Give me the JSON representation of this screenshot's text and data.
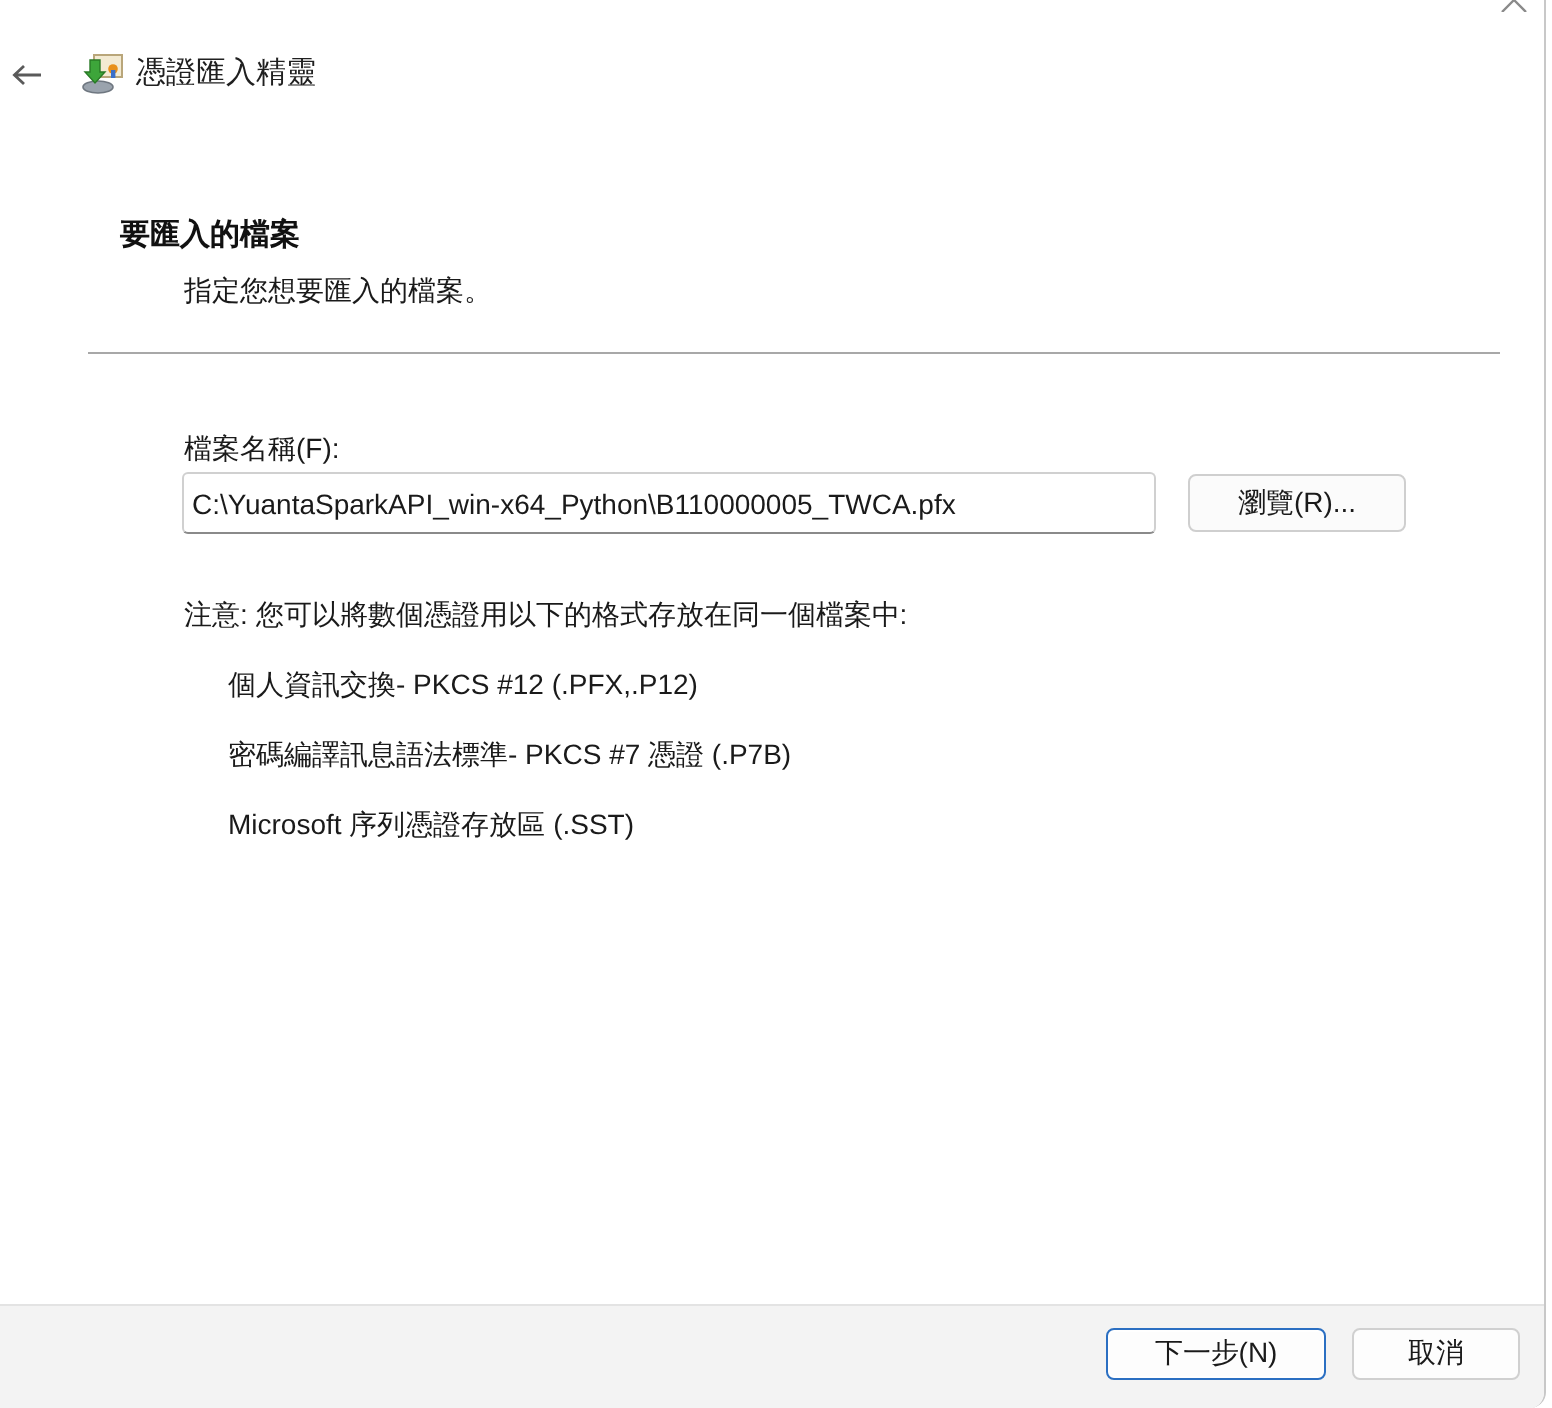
{
  "window": {
    "title": "憑證匯入精靈"
  },
  "page": {
    "heading": "要匯入的檔案",
    "subheading": "指定您想要匯入的檔案。"
  },
  "file_field": {
    "label": "檔案名稱(F):",
    "value": "C:\\YuantaSparkAPI_win-x64_Python\\B110000005_TWCA.pfx",
    "button": "瀏覽(R)..."
  },
  "note": "注意: 您可以將數個憑證用以下的格式存放在同一個檔案中:",
  "formats": [
    "個人資訊交換- PKCS #12 (.PFX,.P12)",
    "密碼編譯訊息語法標準- PKCS #7 憑證 (.P7B)",
    "Microsoft 序列憑證存放區 (.SST)"
  ],
  "buttons": [
    {
      "label": "下一步(N)",
      "default": true
    },
    {
      "label": "取消",
      "default": false
    }
  ]
}
